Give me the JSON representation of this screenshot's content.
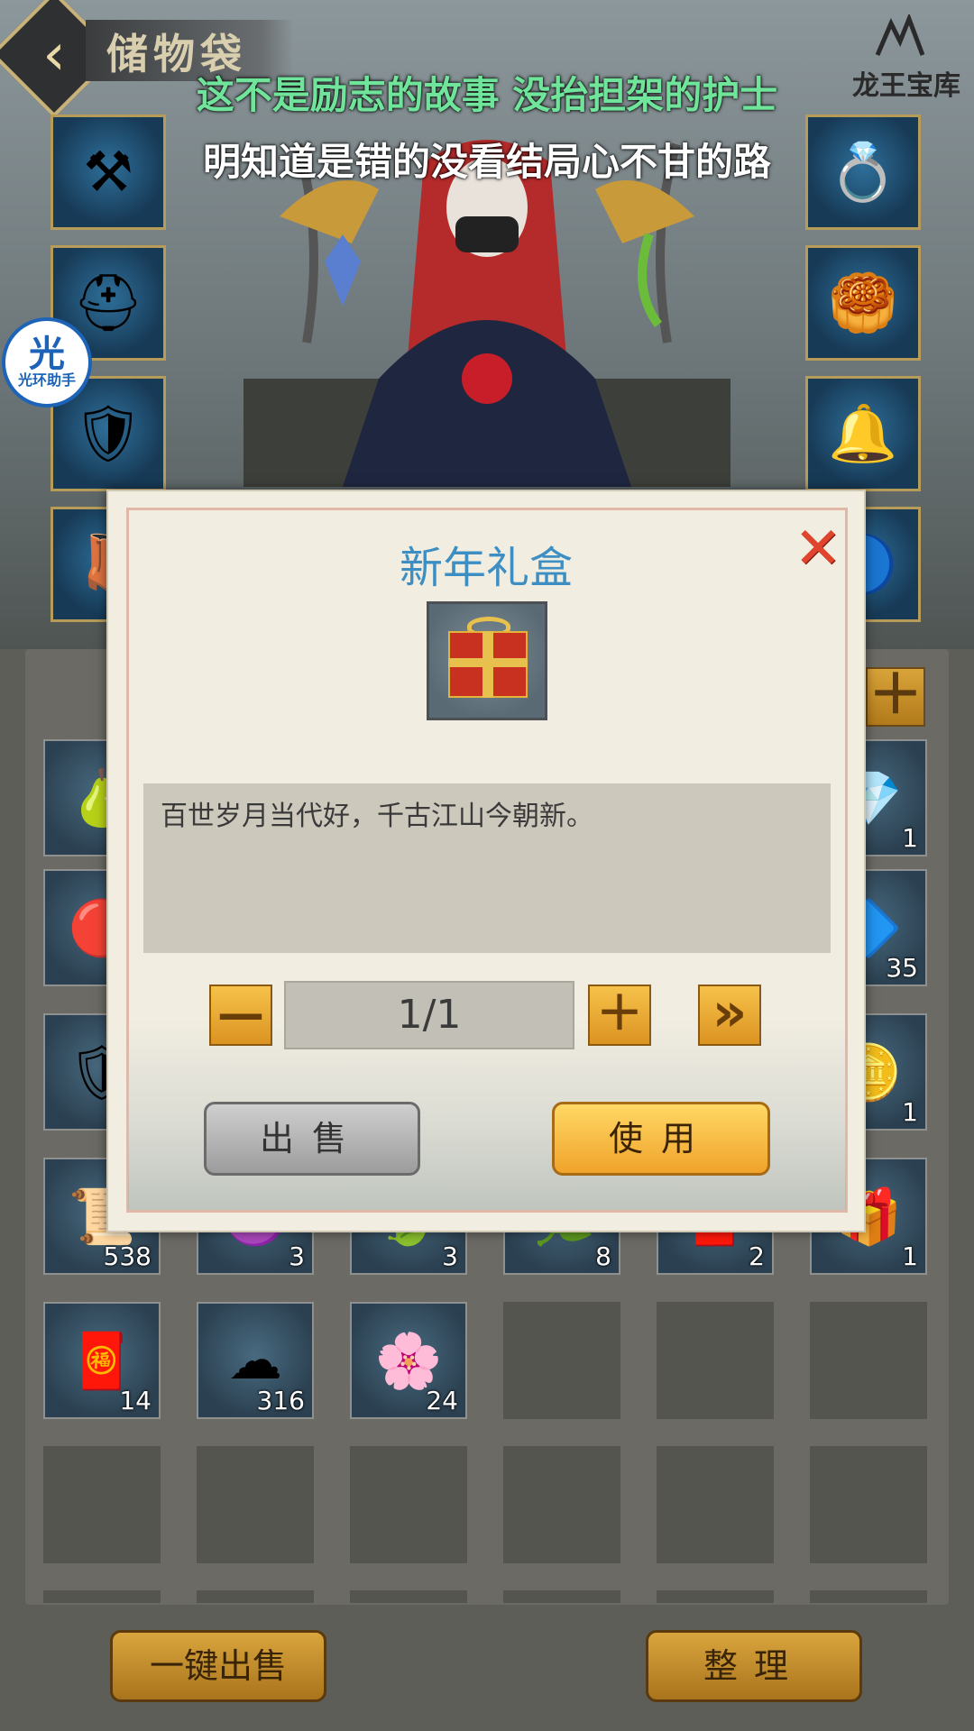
{
  "header": {
    "title": "储物袋",
    "logo_text": "龙王宝库"
  },
  "lyrics": {
    "line1": "这不是励志的故事 没抬担架的护士",
    "line2": "明知道是错的没看结局心不甘的路"
  },
  "assistant_badge": {
    "main": "光",
    "sub": "光环助手"
  },
  "equipment": {
    "left": [
      {
        "name": "bracer-icon",
        "glyph": "⚒"
      },
      {
        "name": "helmet-icon",
        "glyph": "⛑"
      },
      {
        "name": "armor-icon",
        "glyph": "🛡"
      },
      {
        "name": "boots-icon",
        "glyph": "👢"
      }
    ],
    "right": [
      {
        "name": "ring-icon",
        "glyph": "💍"
      },
      {
        "name": "jade-pendant-icon",
        "glyph": "🥮"
      },
      {
        "name": "gold-ring-icon",
        "glyph": "🔔"
      },
      {
        "name": "amulet-icon",
        "glyph": "🔵"
      }
    ]
  },
  "inventory": {
    "rows": [
      [
        {
          "name": "gourd-icon",
          "glyph": "🍐",
          "count": ""
        },
        {
          "name": "hidden",
          "glyph": "",
          "count": ""
        },
        {
          "name": "hidden",
          "glyph": "",
          "count": ""
        },
        {
          "name": "hidden",
          "glyph": "",
          "count": ""
        },
        {
          "name": "hidden",
          "glyph": "",
          "count": ""
        },
        {
          "name": "crystal-shard-icon",
          "glyph": "💎",
          "count": "1"
        }
      ],
      [
        {
          "name": "fire-orb-icon",
          "glyph": "🔴",
          "count": ""
        },
        {
          "name": "hidden",
          "glyph": "",
          "count": ""
        },
        {
          "name": "hidden",
          "glyph": "",
          "count": ""
        },
        {
          "name": "hidden",
          "glyph": "",
          "count": ""
        },
        {
          "name": "hidden",
          "glyph": "",
          "count": ""
        },
        {
          "name": "blue-gem-icon",
          "glyph": "🔷",
          "count": "35"
        }
      ],
      [
        {
          "name": "red-shield-icon",
          "glyph": "🛡",
          "count": ""
        },
        {
          "name": "hidden",
          "glyph": "",
          "count": ""
        },
        {
          "name": "hidden",
          "glyph": "",
          "count": ""
        },
        {
          "name": "hidden",
          "glyph": "",
          "count": ""
        },
        {
          "name": "hidden",
          "glyph": "",
          "count": ""
        },
        {
          "name": "golden-token-icon",
          "glyph": "🪙",
          "count": "1"
        }
      ],
      [
        {
          "name": "scroll-icon",
          "glyph": "📜",
          "count": "538"
        },
        {
          "name": "purple-item-icon",
          "glyph": "🟣",
          "count": "3"
        },
        {
          "name": "green-leaf-icon",
          "glyph": "🍃",
          "count": "3"
        },
        {
          "name": "leaf-icon",
          "glyph": "🌿",
          "count": "8"
        },
        {
          "name": "red-item-icon",
          "glyph": "🧧",
          "count": "2"
        },
        {
          "name": "gift-box-icon",
          "glyph": "🎁",
          "count": "1"
        }
      ],
      [
        {
          "name": "chinese-knot-icon",
          "glyph": "🧧",
          "count": "14"
        },
        {
          "name": "cloud-icon",
          "glyph": "☁",
          "count": "316"
        },
        {
          "name": "purple-flower-icon",
          "glyph": "🌸",
          "count": "24"
        },
        {
          "name": "empty",
          "glyph": "",
          "count": ""
        },
        {
          "name": "empty",
          "glyph": "",
          "count": ""
        },
        {
          "name": "empty",
          "glyph": "",
          "count": ""
        }
      ],
      [
        {
          "name": "empty",
          "glyph": "",
          "count": ""
        },
        {
          "name": "empty",
          "glyph": "",
          "count": ""
        },
        {
          "name": "empty",
          "glyph": "",
          "count": ""
        },
        {
          "name": "empty",
          "glyph": "",
          "count": ""
        },
        {
          "name": "empty",
          "glyph": "",
          "count": ""
        },
        {
          "name": "empty",
          "glyph": "",
          "count": ""
        }
      ]
    ]
  },
  "side_plus": "＋",
  "modal": {
    "title": "新年礼盒",
    "close_glyph": "✕",
    "item_icon": "gift-box-icon",
    "description": "百世岁月当代好，千古江山今朝新。",
    "quantity": "1/1",
    "minus": "—",
    "plus": "＋",
    "max": "»",
    "sell": "出售",
    "use": "使用"
  },
  "footer": {
    "sell_all": "一键出售",
    "organize": "整理"
  }
}
